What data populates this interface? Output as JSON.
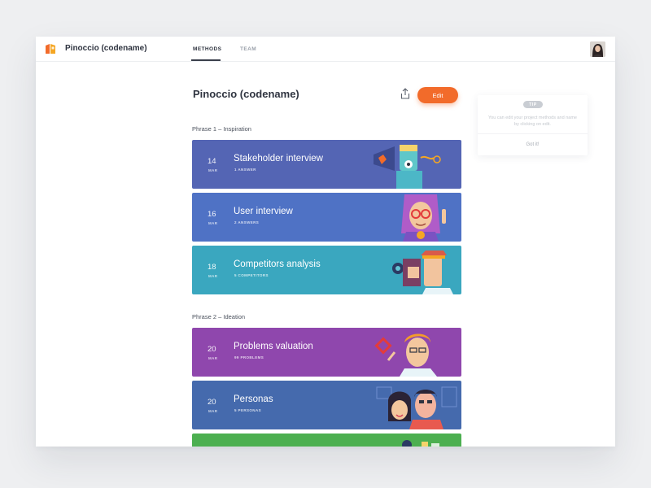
{
  "app": {
    "title": "Pinoccio (codename)"
  },
  "nav": {
    "tabs": [
      {
        "label": "METHODS",
        "active": true
      },
      {
        "label": "TEAM",
        "active": false
      }
    ]
  },
  "page": {
    "title": "Pinoccio (codename)",
    "edit_label": "Edit"
  },
  "phases": [
    {
      "label": "Phrase 1 – Inspiration",
      "items": [
        {
          "day": "14",
          "month": "MAR",
          "title": "Stakeholder interview",
          "subtitle": "1 ANSWER",
          "color": "#5465b4",
          "icon": "megaphone-character-illustration"
        },
        {
          "day": "16",
          "month": "MAR",
          "title": "User interview",
          "subtitle": "2 ANSWERS",
          "color": "#4f72c5",
          "icon": "glasses-girl-illustration"
        },
        {
          "day": "18",
          "month": "MAR",
          "title": "Competitors analysis",
          "subtitle": "5 COMPETITORS",
          "color": "#3aa7bf",
          "icon": "binoculars-characters-illustration"
        }
      ]
    },
    {
      "label": "Phrase 2 – Ideation",
      "items": [
        {
          "day": "20",
          "month": "MAR",
          "title": "Problems valuation",
          "subtitle": "99 PROBLEMS",
          "color": "#8f47ad",
          "icon": "thinking-man-illustration"
        },
        {
          "day": "20",
          "month": "MAR",
          "title": "Personas",
          "subtitle": "5 PERSONAS",
          "color": "#456aad",
          "icon": "personas-couple-illustration"
        }
      ]
    }
  ],
  "tip": {
    "badge": "TIP",
    "text": "You can edit your project methods and name by clicking on edit.",
    "button": "Got it!"
  },
  "colors": {
    "accent": "#f26b2a",
    "next_card": "#4caf50"
  }
}
